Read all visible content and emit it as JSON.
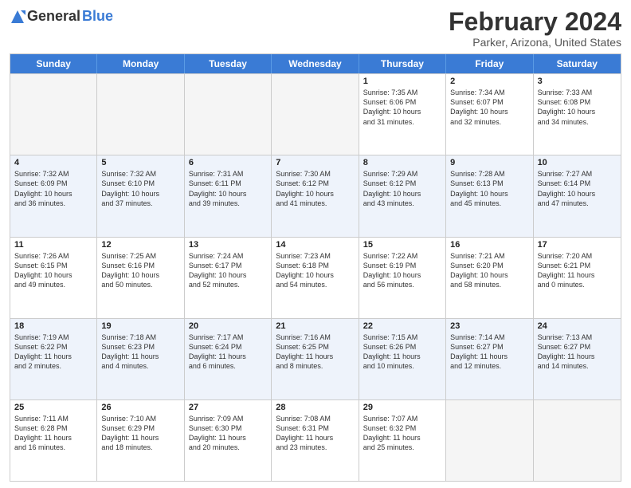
{
  "logo": {
    "general": "General",
    "blue": "Blue"
  },
  "title": "February 2024",
  "subtitle": "Parker, Arizona, United States",
  "headers": [
    "Sunday",
    "Monday",
    "Tuesday",
    "Wednesday",
    "Thursday",
    "Friday",
    "Saturday"
  ],
  "weeks": [
    [
      {
        "day": "",
        "info": ""
      },
      {
        "day": "",
        "info": ""
      },
      {
        "day": "",
        "info": ""
      },
      {
        "day": "",
        "info": ""
      },
      {
        "day": "1",
        "info": "Sunrise: 7:35 AM\nSunset: 6:06 PM\nDaylight: 10 hours\nand 31 minutes."
      },
      {
        "day": "2",
        "info": "Sunrise: 7:34 AM\nSunset: 6:07 PM\nDaylight: 10 hours\nand 32 minutes."
      },
      {
        "day": "3",
        "info": "Sunrise: 7:33 AM\nSunset: 6:08 PM\nDaylight: 10 hours\nand 34 minutes."
      }
    ],
    [
      {
        "day": "4",
        "info": "Sunrise: 7:32 AM\nSunset: 6:09 PM\nDaylight: 10 hours\nand 36 minutes."
      },
      {
        "day": "5",
        "info": "Sunrise: 7:32 AM\nSunset: 6:10 PM\nDaylight: 10 hours\nand 37 minutes."
      },
      {
        "day": "6",
        "info": "Sunrise: 7:31 AM\nSunset: 6:11 PM\nDaylight: 10 hours\nand 39 minutes."
      },
      {
        "day": "7",
        "info": "Sunrise: 7:30 AM\nSunset: 6:12 PM\nDaylight: 10 hours\nand 41 minutes."
      },
      {
        "day": "8",
        "info": "Sunrise: 7:29 AM\nSunset: 6:12 PM\nDaylight: 10 hours\nand 43 minutes."
      },
      {
        "day": "9",
        "info": "Sunrise: 7:28 AM\nSunset: 6:13 PM\nDaylight: 10 hours\nand 45 minutes."
      },
      {
        "day": "10",
        "info": "Sunrise: 7:27 AM\nSunset: 6:14 PM\nDaylight: 10 hours\nand 47 minutes."
      }
    ],
    [
      {
        "day": "11",
        "info": "Sunrise: 7:26 AM\nSunset: 6:15 PM\nDaylight: 10 hours\nand 49 minutes."
      },
      {
        "day": "12",
        "info": "Sunrise: 7:25 AM\nSunset: 6:16 PM\nDaylight: 10 hours\nand 50 minutes."
      },
      {
        "day": "13",
        "info": "Sunrise: 7:24 AM\nSunset: 6:17 PM\nDaylight: 10 hours\nand 52 minutes."
      },
      {
        "day": "14",
        "info": "Sunrise: 7:23 AM\nSunset: 6:18 PM\nDaylight: 10 hours\nand 54 minutes."
      },
      {
        "day": "15",
        "info": "Sunrise: 7:22 AM\nSunset: 6:19 PM\nDaylight: 10 hours\nand 56 minutes."
      },
      {
        "day": "16",
        "info": "Sunrise: 7:21 AM\nSunset: 6:20 PM\nDaylight: 10 hours\nand 58 minutes."
      },
      {
        "day": "17",
        "info": "Sunrise: 7:20 AM\nSunset: 6:21 PM\nDaylight: 11 hours\nand 0 minutes."
      }
    ],
    [
      {
        "day": "18",
        "info": "Sunrise: 7:19 AM\nSunset: 6:22 PM\nDaylight: 11 hours\nand 2 minutes."
      },
      {
        "day": "19",
        "info": "Sunrise: 7:18 AM\nSunset: 6:23 PM\nDaylight: 11 hours\nand 4 minutes."
      },
      {
        "day": "20",
        "info": "Sunrise: 7:17 AM\nSunset: 6:24 PM\nDaylight: 11 hours\nand 6 minutes."
      },
      {
        "day": "21",
        "info": "Sunrise: 7:16 AM\nSunset: 6:25 PM\nDaylight: 11 hours\nand 8 minutes."
      },
      {
        "day": "22",
        "info": "Sunrise: 7:15 AM\nSunset: 6:26 PM\nDaylight: 11 hours\nand 10 minutes."
      },
      {
        "day": "23",
        "info": "Sunrise: 7:14 AM\nSunset: 6:27 PM\nDaylight: 11 hours\nand 12 minutes."
      },
      {
        "day": "24",
        "info": "Sunrise: 7:13 AM\nSunset: 6:27 PM\nDaylight: 11 hours\nand 14 minutes."
      }
    ],
    [
      {
        "day": "25",
        "info": "Sunrise: 7:11 AM\nSunset: 6:28 PM\nDaylight: 11 hours\nand 16 minutes."
      },
      {
        "day": "26",
        "info": "Sunrise: 7:10 AM\nSunset: 6:29 PM\nDaylight: 11 hours\nand 18 minutes."
      },
      {
        "day": "27",
        "info": "Sunrise: 7:09 AM\nSunset: 6:30 PM\nDaylight: 11 hours\nand 20 minutes."
      },
      {
        "day": "28",
        "info": "Sunrise: 7:08 AM\nSunset: 6:31 PM\nDaylight: 11 hours\nand 23 minutes."
      },
      {
        "day": "29",
        "info": "Sunrise: 7:07 AM\nSunset: 6:32 PM\nDaylight: 11 hours\nand 25 minutes."
      },
      {
        "day": "",
        "info": ""
      },
      {
        "day": "",
        "info": ""
      }
    ]
  ]
}
